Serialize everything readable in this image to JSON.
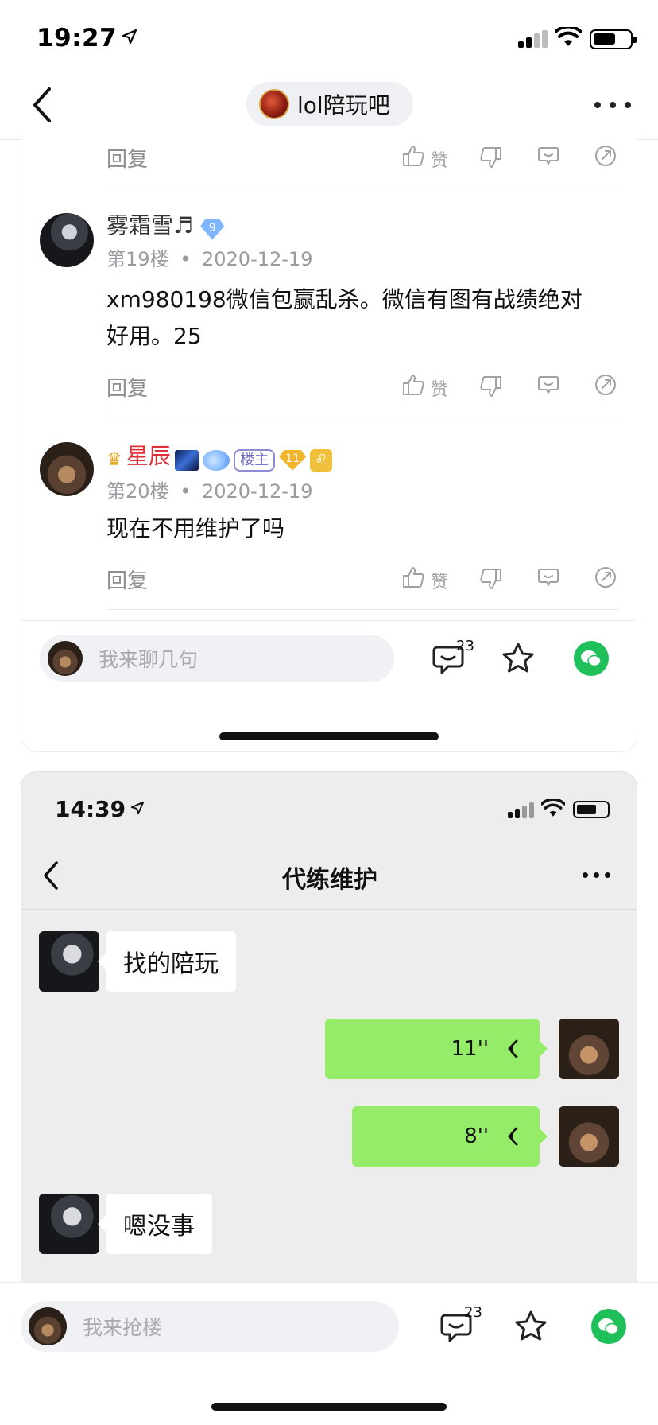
{
  "status_bar": {
    "time": "19:27"
  },
  "nav": {
    "forum_name": "lol陪玩吧"
  },
  "comments": {
    "top_row": {
      "reply_label": "回复",
      "zan_label": "赞"
    },
    "items": [
      {
        "username": "雾霜雪♬",
        "level_badge": "9",
        "floor": "第19楼",
        "date": "2020-12-19",
        "text_line1": "xm980198微信包赢乱杀。微信有图有战绩绝对",
        "text_line2": "好用。25",
        "reply_label": "回复",
        "zan_label": "赞"
      },
      {
        "username": "星辰",
        "host_badge": "楼主",
        "level_badge": "11",
        "zodiac_badge": "♌",
        "floor": "第20楼",
        "date": "2020-12-19",
        "text_line1": "现在不用维护了吗",
        "reply_label": "回复",
        "zan_label": "赞"
      }
    ],
    "meta_separator": "•"
  },
  "composer_top": {
    "placeholder": "我来聊几句",
    "comment_count": "23"
  },
  "embedded_chat": {
    "status_time": "14:39",
    "title": "代练维护",
    "messages": [
      {
        "side": "left",
        "text": "找的陪玩"
      },
      {
        "side": "right",
        "duration": "11''"
      },
      {
        "side": "right",
        "duration": "8''"
      },
      {
        "side": "left",
        "text": "嗯没事"
      }
    ]
  },
  "composer_bottom": {
    "placeholder": "我来抢楼",
    "comment_count": "23"
  },
  "colors": {
    "wechat_green": "#1fbf5a",
    "voice_bubble": "#95ec69",
    "host_name_red": "#e0303a"
  },
  "icons": [
    "back-chevron-icon",
    "more-dots-icon",
    "thumb-up-icon",
    "thumb-down-icon",
    "smile-reply-icon",
    "share-icon",
    "comment-icon",
    "star-icon",
    "wechat-icon",
    "voice-wave-icon"
  ]
}
